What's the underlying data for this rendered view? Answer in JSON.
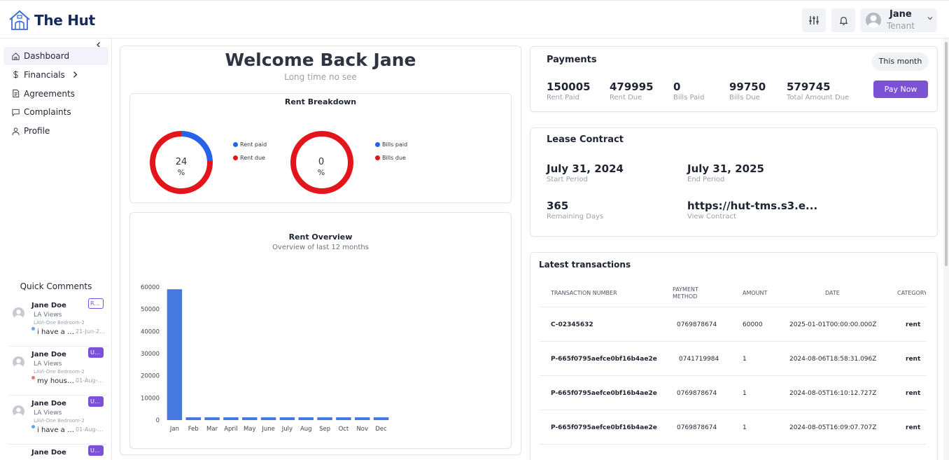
{
  "app": {
    "name": "The Hut"
  },
  "header": {
    "user_name": "Jane",
    "user_role": "Tenant"
  },
  "sidebar": {
    "items": [
      {
        "label": "Dashboard",
        "icon": "home-icon",
        "active": true
      },
      {
        "label": "Financials",
        "icon": "dollar-icon",
        "has_submenu": true
      },
      {
        "label": "Agreements",
        "icon": "document-icon"
      },
      {
        "label": "Complaints",
        "icon": "chat-icon"
      },
      {
        "label": "Profile",
        "icon": "user-icon"
      }
    ],
    "quick_comments_title": "Quick Comments",
    "quick_comments": [
      {
        "name": "Jane Doe",
        "property": "LA Views",
        "unit": "LAVi-One Bedroom-2",
        "badge": "Re...",
        "badge_style": "outline",
        "dot_color": "#60a5fa",
        "text": "i have a pr...",
        "date": "21-Jun-2..."
      },
      {
        "name": "Jane Doe",
        "property": "LA Views",
        "unit": "LAVi-One Bedroom-2",
        "badge": "Un...",
        "badge_style": "fill",
        "dot_color": "#f87171",
        "text": "my house ...",
        "date": "01-Aug-2..."
      },
      {
        "name": "Jane Doe",
        "property": "LA Views",
        "unit": "LAVi-One Bedroom-2",
        "badge": "Un...",
        "badge_style": "fill",
        "dot_color": "#60a5fa",
        "text": "i have a ra...",
        "date": "01-Aug-2..."
      },
      {
        "name": "Jane Doe",
        "property": "",
        "unit": "",
        "badge": "Un...",
        "badge_style": "fill",
        "dot_color": "",
        "text": "",
        "date": ""
      }
    ]
  },
  "welcome": {
    "title": "Welcome Back Jane",
    "subtitle": "Long time no see"
  },
  "rent_breakdown": {
    "title": "Rent Breakdown",
    "rent": {
      "value": "24",
      "unit": "%",
      "paid_fraction": 0.24,
      "legend_paid": "Rent paid",
      "legend_due": "Rent due"
    },
    "bills": {
      "value": "0",
      "unit": "%",
      "paid_fraction": 0,
      "legend_paid": "Bills paid",
      "legend_due": "Bills due"
    },
    "colors": {
      "paid": "#2563eb",
      "due": "#e3151b"
    }
  },
  "rent_overview": {
    "title": "Rent Overview",
    "subtitle": "Overview of last 12 months"
  },
  "chart_data": {
    "type": "bar",
    "title": "Rent Overview",
    "subtitle": "Overview of last 12 months",
    "categories": [
      "Jan",
      "Feb",
      "Mar",
      "April",
      "May",
      "June",
      "July",
      "Aug",
      "Sep",
      "Oct",
      "Nov",
      "Dec"
    ],
    "values": [
      59000,
      0,
      0,
      0,
      0,
      0,
      0,
      0,
      0,
      0,
      0,
      0
    ],
    "ylim": [
      0,
      60000
    ],
    "yticks": [
      0,
      10000,
      20000,
      30000,
      40000,
      50000,
      60000
    ],
    "color": "#4778e0",
    "grid": false
  },
  "payments": {
    "title": "Payments",
    "period": "This month",
    "stats": [
      {
        "value": "150005",
        "label": "Rent Paid"
      },
      {
        "value": "479995",
        "label": "Rent Due"
      },
      {
        "value": "0",
        "label": "Bills Paid"
      },
      {
        "value": "99750",
        "label": "Bills Due"
      },
      {
        "value": "579745",
        "label": "Total Amount Due"
      }
    ],
    "pay_button": "Pay Now"
  },
  "lease": {
    "title": "Lease Contract",
    "start": {
      "value": "July 31, 2024",
      "label": "Start Period"
    },
    "end": {
      "value": "July 31, 2025",
      "label": "End Period"
    },
    "remaining": {
      "value": "365",
      "label": "Remaining Days"
    },
    "contract": {
      "value": "https://hut-tms.s3.e...",
      "label": "View Contract"
    }
  },
  "transactions": {
    "title": "Latest transactions",
    "headers": [
      "TRANSACTION NUMBER",
      "PAYMENT METHOD",
      "AMOUNT",
      "DATE",
      "CATEGORY"
    ],
    "rows": [
      [
        "C-02345632",
        "0769878674",
        "60000",
        "2025-01-01T00:00:00.000Z",
        "rent"
      ],
      [
        "P-665f0795aefce0bf16b4ae2e",
        "0741719984",
        "1",
        "2024-08-06T18:58:31.096Z",
        "rent"
      ],
      [
        "P-665f0795aefce0bf16b4ae2e",
        "0769878674",
        "1",
        "2024-08-05T16:10:12.727Z",
        "rent"
      ],
      [
        "P-665f0795aefce0bf16b4ae2e",
        "0769878674",
        "1",
        "2024-08-05T16:09:07.707Z",
        "rent"
      ]
    ]
  }
}
